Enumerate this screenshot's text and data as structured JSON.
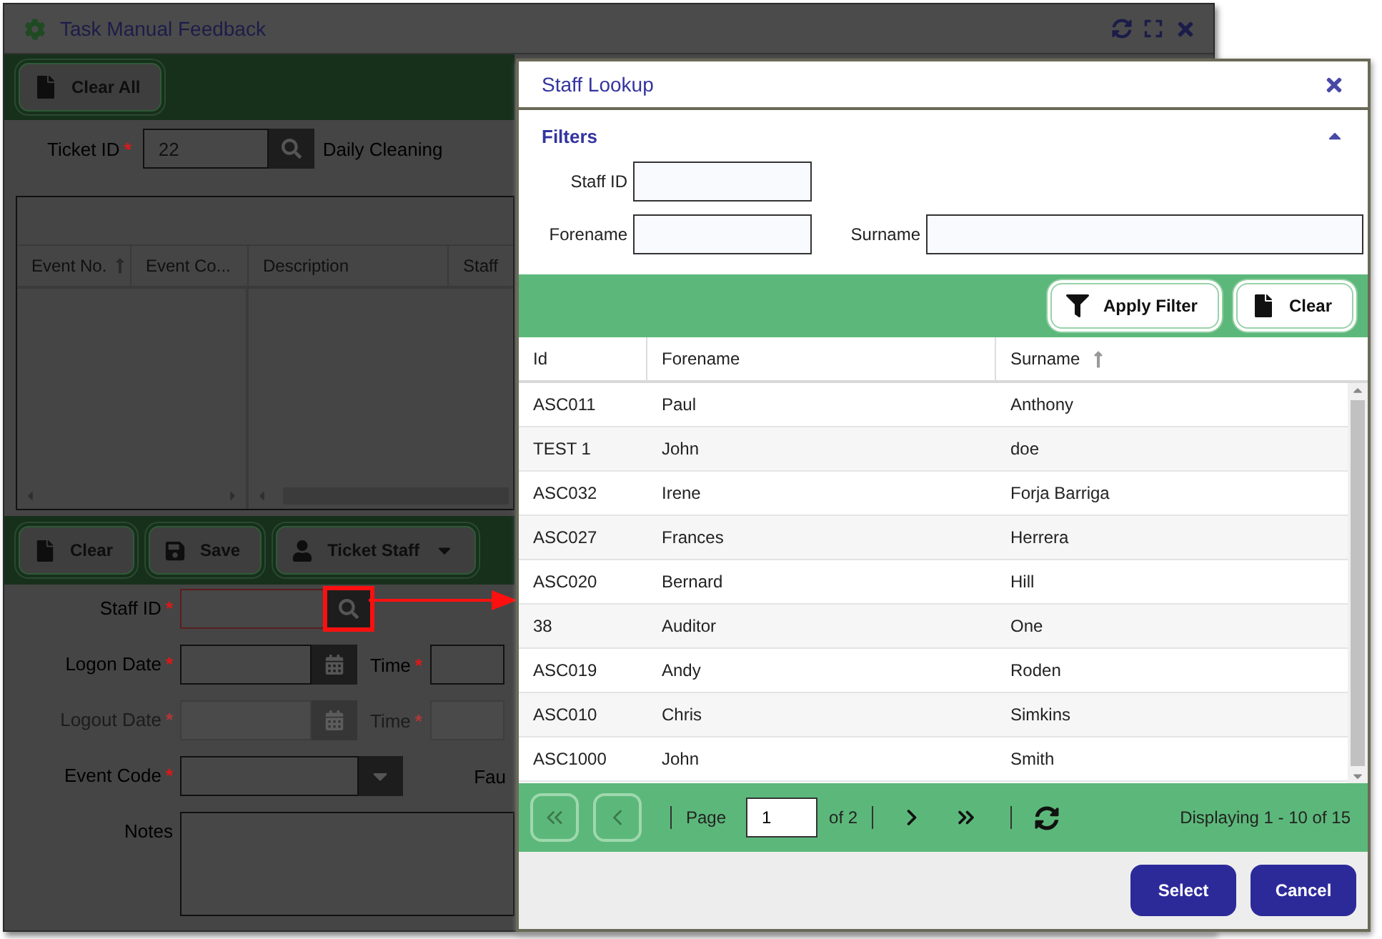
{
  "window": {
    "title": "Task Manual Feedback"
  },
  "toolbar": {
    "buttons": [
      {
        "label": "Clear All",
        "kind": "file"
      }
    ]
  },
  "ticket": {
    "label": "Ticket ID",
    "required": true,
    "value": "22",
    "description": "Daily Cleaning"
  },
  "events_table": {
    "columns": [
      {
        "label": "Event No.",
        "sorted": true
      },
      {
        "label": "Event Co...",
        "sorted": false
      },
      {
        "label": "Description",
        "sorted": false
      },
      {
        "label": "Staff",
        "sorted": false
      }
    ]
  },
  "form_toolbar": {
    "buttons": [
      {
        "label": "Clear",
        "kind": "file",
        "dropdown": false
      },
      {
        "label": "Save",
        "kind": "save",
        "dropdown": false
      },
      {
        "label": "Ticket Staff",
        "kind": "person",
        "dropdown": true
      }
    ]
  },
  "form": {
    "required_mark": "*",
    "fields": [
      {
        "label": "Staff ID",
        "kind": "lookup",
        "required": true,
        "disabled": false,
        "highlighted": true
      },
      {
        "label": "Logon Date",
        "kind": "date",
        "required": true,
        "disabled": false,
        "time_label": "Time"
      },
      {
        "label": "Logout Date",
        "kind": "date",
        "required": true,
        "disabled": true,
        "time_label": "Time"
      },
      {
        "label": "Event Code",
        "kind": "select",
        "required": true,
        "disabled": false,
        "side_label": "Fau"
      },
      {
        "label": "Notes",
        "kind": "notes",
        "required": false,
        "disabled": false
      }
    ]
  },
  "dialog": {
    "title": "Staff Lookup",
    "filters": {
      "title": "Filters",
      "expanded": true,
      "fields": [
        {
          "label": "Staff ID"
        },
        {
          "label": "Forename"
        },
        {
          "label": "Surname"
        }
      ]
    },
    "actions": [
      {
        "label": "Apply Filter",
        "kind": "filter"
      },
      {
        "label": "Clear",
        "kind": "file"
      }
    ],
    "table": {
      "columns": [
        {
          "label": "Id",
          "sorted": false
        },
        {
          "label": "Forename",
          "sorted": false
        },
        {
          "label": "Surname",
          "sorted": true
        }
      ],
      "rows": [
        [
          "ASC011",
          "Paul",
          "Anthony"
        ],
        [
          "TEST 1",
          "John",
          "doe"
        ],
        [
          "ASC032",
          "Irene",
          "Forja Barriga"
        ],
        [
          "ASC027",
          "Frances",
          "Herrera"
        ],
        [
          "ASC020",
          "Bernard",
          "Hill"
        ],
        [
          "38",
          "Auditor",
          "One"
        ],
        [
          "ASC019",
          "Andy",
          "Roden"
        ],
        [
          "ASC010",
          "Chris",
          "Simkins"
        ],
        [
          "ASC1000",
          "John",
          "Smith"
        ]
      ]
    },
    "pager": {
      "nav": [
        {
          "kind": "first",
          "disabled": true
        },
        {
          "kind": "prev",
          "disabled": true
        }
      ],
      "page_label": "Page",
      "page": "1",
      "of": "of 2",
      "nav_after": [
        {
          "kind": "next",
          "disabled": false
        },
        {
          "kind": "last",
          "disabled": false
        }
      ],
      "status": "Displaying 1 - 10 of 15"
    },
    "buttons": [
      {
        "label": "Select"
      },
      {
        "label": "Cancel"
      }
    ]
  }
}
